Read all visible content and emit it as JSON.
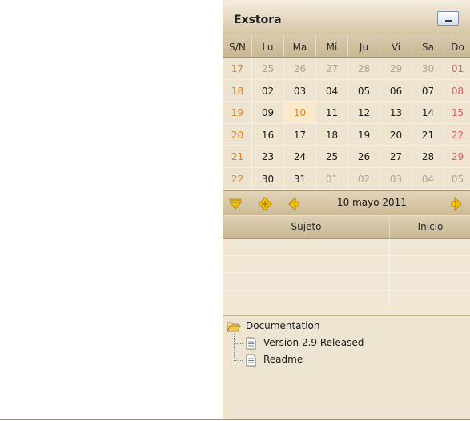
{
  "app": {
    "title": "Exstora"
  },
  "calendar": {
    "headers": [
      "S/N",
      "Lu",
      "Ma",
      "Mi",
      "Ju",
      "Vi",
      "Sa",
      "Do"
    ],
    "weeks": [
      {
        "week": "17",
        "days": [
          "25",
          "26",
          "27",
          "28",
          "29",
          "30",
          "01"
        ]
      },
      {
        "week": "18",
        "days": [
          "02",
          "03",
          "04",
          "05",
          "06",
          "07",
          "08"
        ]
      },
      {
        "week": "19",
        "days": [
          "09",
          "10",
          "11",
          "12",
          "13",
          "14",
          "15"
        ]
      },
      {
        "week": "20",
        "days": [
          "16",
          "17",
          "18",
          "19",
          "20",
          "21",
          "22"
        ]
      },
      {
        "week": "21",
        "days": [
          "23",
          "24",
          "25",
          "26",
          "27",
          "28",
          "29"
        ]
      },
      {
        "week": "22",
        "days": [
          "30",
          "31",
          "01",
          "02",
          "03",
          "04",
          "05"
        ]
      }
    ],
    "selected_day": "10"
  },
  "navigator": {
    "current_date": "10 mayo 2011"
  },
  "events": {
    "columns": [
      "Sujeto",
      "Inicio"
    ]
  },
  "tree": {
    "root": "Documentation",
    "children": [
      "Version 2.9 Released",
      "Readme"
    ]
  },
  "colors": {
    "panel_bg": "#ede4d2",
    "weeknum": "#d3852a",
    "sunday": "#e05a5a",
    "other_month": "#a8a39a",
    "today_bg": "#fbe9cc",
    "nav_icon": "#f2c200"
  },
  "icons": {
    "minimize": "minimize-icon",
    "collapse": "collapse-down-icon",
    "today": "today-icon",
    "prev": "prev-arrow-icon",
    "next": "next-arrow-icon",
    "folder": "folder-open-icon",
    "document": "document-icon"
  }
}
